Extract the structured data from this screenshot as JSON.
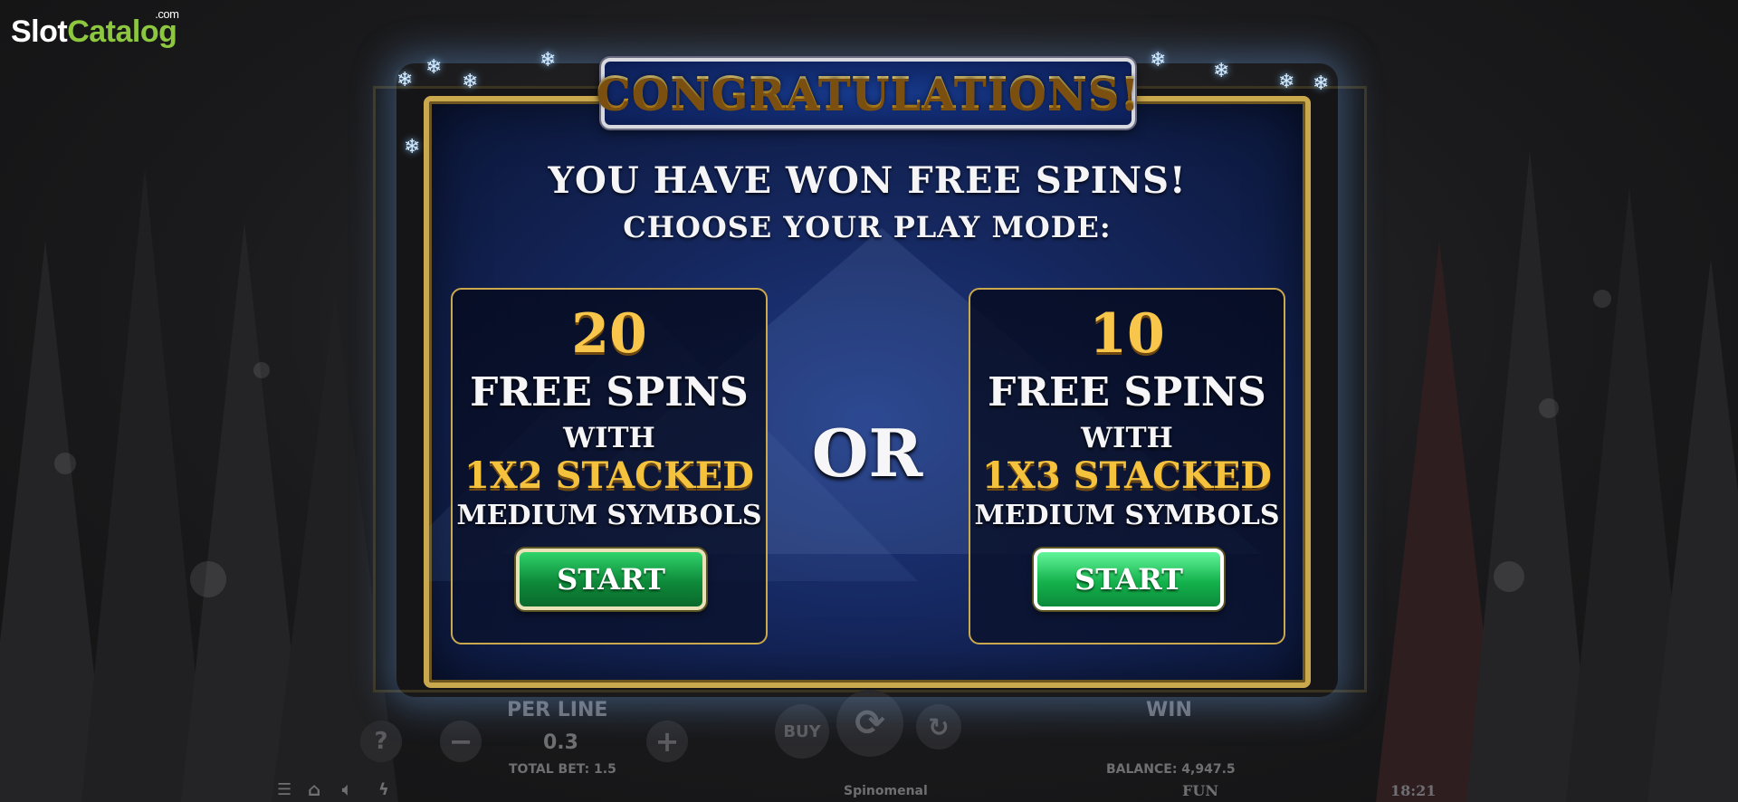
{
  "watermark": {
    "slot": "Slot",
    "catalog": "Catalog",
    "com": ".com"
  },
  "popup": {
    "title": "CONGRATULATIONS!",
    "headline": "YOU HAVE WON FREE SPINS!",
    "subheadline": "CHOOSE YOUR PLAY MODE:",
    "separator": "OR",
    "options": [
      {
        "count": "20",
        "label": "FREE SPINS",
        "with": "WITH",
        "stacked": "1X2 STACKED",
        "symbols": "MEDIUM SYMBOLS",
        "button": "START"
      },
      {
        "count": "10",
        "label": "FREE SPINS",
        "with": "WITH",
        "stacked": "1X3 STACKED",
        "symbols": "MEDIUM SYMBOLS",
        "button": "START"
      }
    ]
  },
  "controls": {
    "help": "?",
    "minus": "−",
    "plus": "+",
    "per_line_label": "PER LINE",
    "per_line_value": "0.3",
    "total_bet": "TOTAL BET: 1.5",
    "buy": "BUY",
    "win_label": "WIN",
    "balance": "BALANCE: 4,947.5",
    "provider": "Spinomenal",
    "mode": "FUN",
    "clock": "18:21"
  },
  "icons": [
    "help-icon",
    "spin-icon",
    "autoplay-icon",
    "menu-icon",
    "home-icon",
    "sound-icon",
    "lightning-icon"
  ]
}
